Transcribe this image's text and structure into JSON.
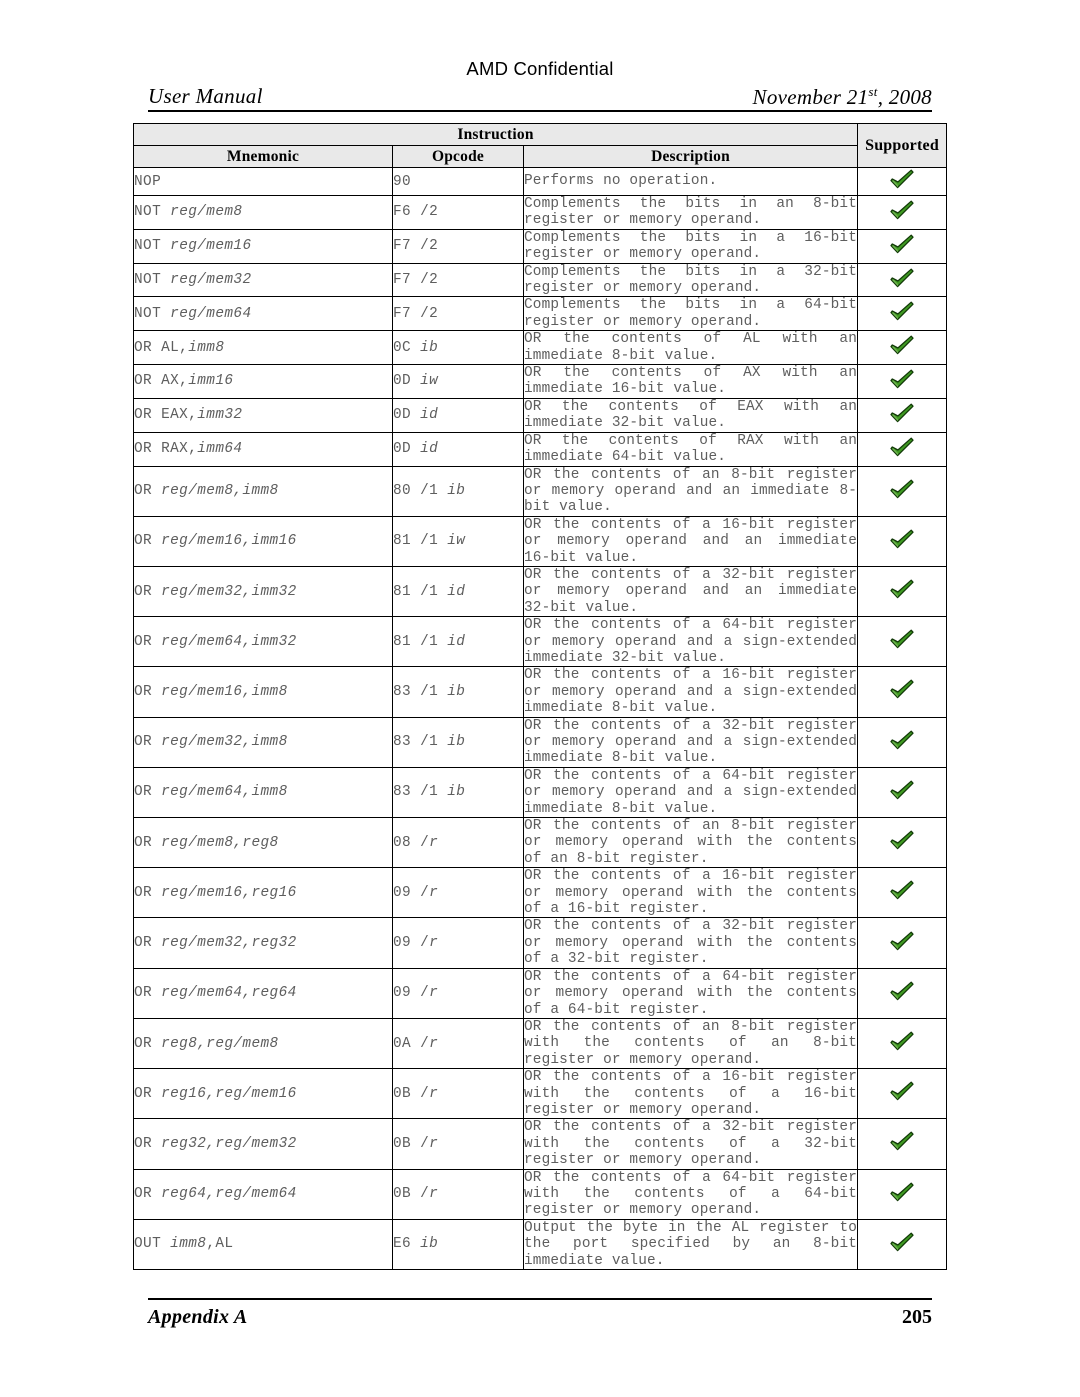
{
  "header": {
    "confidential": "AMD Confidential",
    "doc_title": "User Manual",
    "date_main": "November 21",
    "date_ordinal": "st",
    "date_year": ", 2008"
  },
  "table": {
    "group_header": "Instruction",
    "columns": [
      "Mnemonic",
      "Opcode",
      "Description",
      "Supported"
    ],
    "supported_icon": "green-check-icon",
    "supported_color": "#3f9a22",
    "rows": [
      {
        "mnemonic_op": "NOP",
        "mnemonic_arg": "",
        "opcode_hex": "90",
        "opcode_suffix": "",
        "description": "Performs no operation.",
        "supported": true
      },
      {
        "mnemonic_op": "NOT ",
        "mnemonic_arg": "reg/mem8",
        "opcode_hex": "F6 /2",
        "opcode_suffix": "",
        "description": "Complements the bits in an 8-bit register or memory operand.",
        "supported": true
      },
      {
        "mnemonic_op": "NOT ",
        "mnemonic_arg": "reg/mem16",
        "opcode_hex": "F7 /2",
        "opcode_suffix": "",
        "description": "Complements the bits in a 16-bit register or memory operand.",
        "supported": true
      },
      {
        "mnemonic_op": "NOT ",
        "mnemonic_arg": "reg/mem32",
        "opcode_hex": "F7 /2",
        "opcode_suffix": "",
        "description": "Complements the bits in a 32-bit register or memory operand.",
        "supported": true
      },
      {
        "mnemonic_op": "NOT ",
        "mnemonic_arg": "reg/mem64",
        "opcode_hex": "F7 /2",
        "opcode_suffix": "",
        "description": "Complements the bits in a 64-bit register or memory operand.",
        "supported": true
      },
      {
        "mnemonic_op": "OR AL,",
        "mnemonic_arg": "imm8",
        "opcode_hex": "0C ",
        "opcode_suffix": "ib",
        "description": "OR the contents of AL with an immediate 8-bit value.",
        "supported": true
      },
      {
        "mnemonic_op": "OR AX,",
        "mnemonic_arg": "imm16",
        "opcode_hex": "0D ",
        "opcode_suffix": "iw",
        "description": "OR the contents of AX with an immediate 16-bit value.",
        "supported": true
      },
      {
        "mnemonic_op": "OR EAX,",
        "mnemonic_arg": "imm32",
        "opcode_hex": "0D ",
        "opcode_suffix": "id",
        "description": "OR the contents of EAX with an immediate 32-bit value.",
        "supported": true
      },
      {
        "mnemonic_op": "OR RAX,",
        "mnemonic_arg": "imm64",
        "opcode_hex": "0D ",
        "opcode_suffix": "id",
        "description": "OR the contents of RAX with an immediate 64-bit value.",
        "supported": true
      },
      {
        "mnemonic_op": "OR ",
        "mnemonic_arg": "reg/mem8,imm8",
        "opcode_hex": "80 /1 ",
        "opcode_suffix": "ib",
        "description": "OR the contents of an 8-bit register or memory operand and an immediate 8-bit value.",
        "supported": true
      },
      {
        "mnemonic_op": "OR ",
        "mnemonic_arg": "reg/mem16,imm16",
        "opcode_hex": "81 /1 ",
        "opcode_suffix": "iw",
        "description": "OR the contents of a 16-bit register or memory operand and an immediate 16-bit value.",
        "supported": true
      },
      {
        "mnemonic_op": "OR ",
        "mnemonic_arg": "reg/mem32,imm32",
        "opcode_hex": "81 /1 ",
        "opcode_suffix": "id",
        "description": "OR the contents of a 32-bit register or memory operand and an immediate 32-bit value.",
        "supported": true
      },
      {
        "mnemonic_op": "OR ",
        "mnemonic_arg": "reg/mem64,imm32",
        "opcode_hex": "81 /1 ",
        "opcode_suffix": "id",
        "description": "OR the contents of a 64-bit register or memory operand and a sign-extended immediate 32-bit value.",
        "supported": true
      },
      {
        "mnemonic_op": "OR ",
        "mnemonic_arg": "reg/mem16,imm8",
        "opcode_hex": "83 /1 ",
        "opcode_suffix": "ib",
        "description": "OR the contents of a 16-bit register or memory operand and a sign-extended immediate 8-bit value.",
        "supported": true
      },
      {
        "mnemonic_op": "OR ",
        "mnemonic_arg": "reg/mem32,imm8",
        "opcode_hex": "83 /1 ",
        "opcode_suffix": "ib",
        "description": "OR the contents of a 32-bit register or memory operand and a sign-extended immediate 8-bit value.",
        "supported": true
      },
      {
        "mnemonic_op": "OR ",
        "mnemonic_arg": "reg/mem64,imm8",
        "opcode_hex": "83 /1 ",
        "opcode_suffix": "ib",
        "description": "OR the contents of a 64-bit register or memory operand and a sign-extended immediate 8-bit value.",
        "supported": true
      },
      {
        "mnemonic_op": "OR ",
        "mnemonic_arg": "reg/mem8,reg8",
        "opcode_hex": "08 /",
        "opcode_suffix": "r",
        "description": "OR the contents of an 8-bit register or memory operand with the contents of an 8-bit register.",
        "supported": true
      },
      {
        "mnemonic_op": "OR ",
        "mnemonic_arg": "reg/mem16,reg16",
        "opcode_hex": "09 /",
        "opcode_suffix": "r",
        "description": "OR the contents of a 16-bit register or memory operand with the contents of a 16-bit register.",
        "supported": true
      },
      {
        "mnemonic_op": "OR ",
        "mnemonic_arg": "reg/mem32,reg32",
        "opcode_hex": "09 /",
        "opcode_suffix": "r",
        "description": "OR the contents of a 32-bit register or memory operand with the contents of a 32-bit register.",
        "supported": true
      },
      {
        "mnemonic_op": "OR ",
        "mnemonic_arg": "reg/mem64,reg64",
        "opcode_hex": "09 /",
        "opcode_suffix": "r",
        "description": "OR the contents of a 64-bit register or memory operand with the contents of a 64-bit register.",
        "supported": true
      },
      {
        "mnemonic_op": "OR ",
        "mnemonic_arg": "reg8,reg/mem8",
        "opcode_hex": "0A /",
        "opcode_suffix": "r",
        "description": "OR the contents of an 8-bit register with the contents of an 8-bit register or memory operand.",
        "supported": true
      },
      {
        "mnemonic_op": "OR ",
        "mnemonic_arg": "reg16,reg/mem16",
        "opcode_hex": "0B /",
        "opcode_suffix": "r",
        "description": "OR the contents of a 16-bit register with the contents of a 16-bit register or memory operand.",
        "supported": true
      },
      {
        "mnemonic_op": "OR ",
        "mnemonic_arg": "reg32,reg/mem32",
        "opcode_hex": "0B /",
        "opcode_suffix": "r",
        "description": "OR the contents of a 32-bit register with the contents of a 32-bit register or memory operand.",
        "supported": true
      },
      {
        "mnemonic_op": "OR ",
        "mnemonic_arg": "reg64,reg/mem64",
        "opcode_hex": "0B /",
        "opcode_suffix": "r",
        "description": "OR the contents of a 64-bit register with the contents of a 64-bit register or memory operand.",
        "supported": true
      },
      {
        "mnemonic_op": "OUT ",
        "mnemonic_arg": "imm8",
        "mnemonic_tail": ",AL",
        "opcode_hex": "E6 ",
        "opcode_suffix": "ib",
        "description": "Output the byte in the AL register to the port specified by an 8-bit immediate value.",
        "supported": true
      }
    ]
  },
  "footer": {
    "section": "Appendix A",
    "page_number": "205"
  }
}
